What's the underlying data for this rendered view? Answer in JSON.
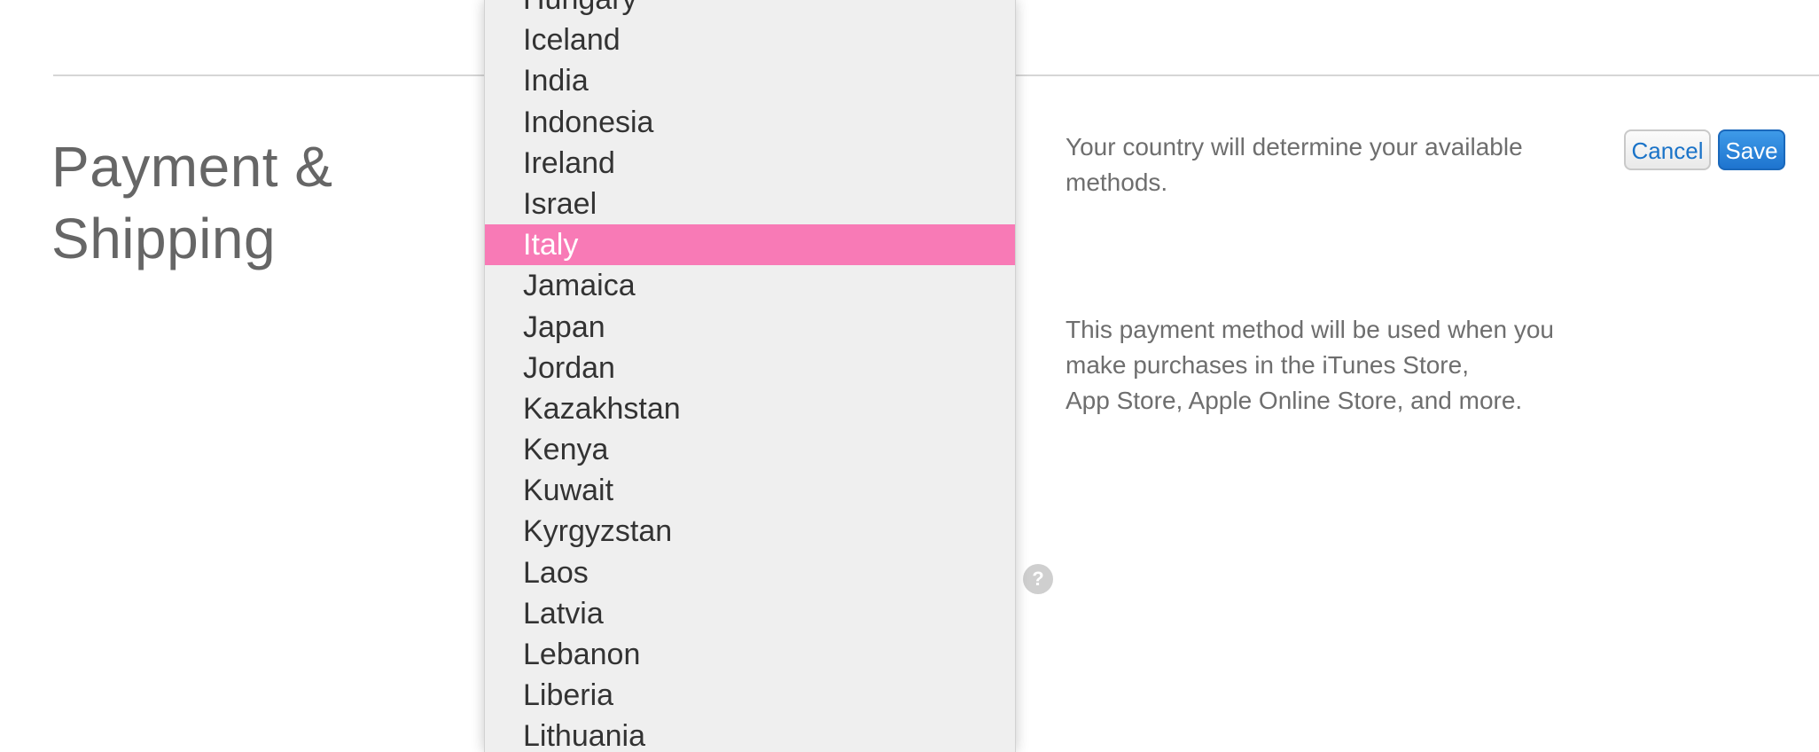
{
  "section": {
    "title": "Payment & Shipping"
  },
  "country": {
    "note": "Your country will determine your available methods."
  },
  "payment": {
    "note_lines": [
      "This payment method will be used when you",
      "make purchases in the iTunes Store,",
      "App Store, Apple Online Store, and more."
    ]
  },
  "buttons": {
    "cancel_label": "Cancel",
    "save_label": "Save"
  },
  "help": {
    "icon_glyph": "?"
  },
  "country_dropdown": {
    "selected": "Italy",
    "options": [
      "Hungary",
      "Iceland",
      "India",
      "Indonesia",
      "Ireland",
      "Israel",
      "Italy",
      "Jamaica",
      "Japan",
      "Jordan",
      "Kazakhstan",
      "Kenya",
      "Kuwait",
      "Kyrgyzstan",
      "Laos",
      "Latvia",
      "Lebanon",
      "Liberia",
      "Lithuania"
    ]
  },
  "colors": {
    "selected_highlight": "#f87ab6",
    "primary_button": "#1e74cf",
    "link_text": "#1a73c8",
    "body_text": "#6e6e6e"
  }
}
